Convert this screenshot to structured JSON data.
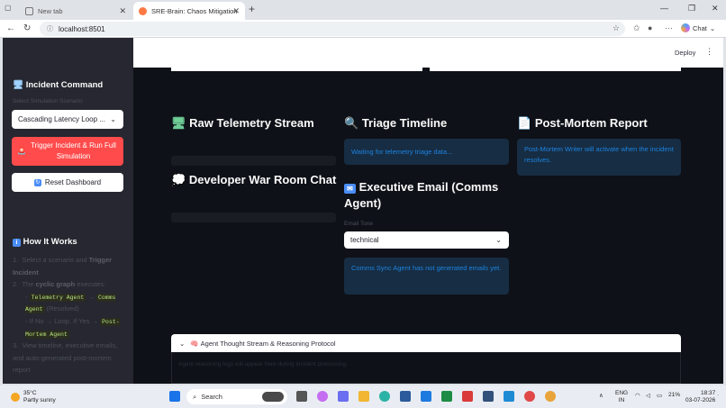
{
  "browser": {
    "tabs": [
      {
        "title": "New tab",
        "active": false
      },
      {
        "title": "SRE-Brain: Chaos Mitigation Centre",
        "active": true
      }
    ],
    "url": "localhost:8501",
    "chat_label": "Chat"
  },
  "header": {
    "deploy_label": "Deploy"
  },
  "sidebar": {
    "title": "Incident Command",
    "scenario_label": "Select Simulation Scenario",
    "scenario_value": "Cascading Latency Loop ...",
    "trigger_button": "Trigger Incident & Run Full Simulation",
    "reset_button": "Reset Dashboard",
    "how_title": "How It Works",
    "how": {
      "step1_pre": "Select a scenario and ",
      "step1_bold": "Trigger Incident",
      "step2_pre": "The ",
      "step2_bold": "cyclic graph",
      "step2_post": " executes:",
      "sub1_code_a": "Telemetry Agent",
      "sub1_arrow": " → ",
      "sub1_code_b": "Comms Agent",
      "sub1_post": " (Resolved)",
      "sub2_pre": "If No → Loop. If Yes → ",
      "sub2_code": "Post-Mortem Agent",
      "step3": "View timeline, executive emails, and auto-generated post-mortem report"
    }
  },
  "main": {
    "telemetry_title": "Raw Telemetry Stream",
    "warroom_title": "Developer War Room Chat",
    "triage_title": "Triage Timeline",
    "triage_info": "Waiting for telemetry triage data...",
    "email_title": "Executive Email (Comms Agent)",
    "email_tone_label": "Email Tone",
    "email_tone_value": "technical",
    "email_info": "Comms Sync Agent has not generated emails yet.",
    "postmortem_title": "Post-Mortem Report",
    "postmortem_info": "Post-Mortem Writer will activate when the incident resolves.",
    "expander_title": "Agent Thought Stream & Reasoning Protocol",
    "expander_body": "Agent reasoning logs will appear here during incident processing."
  },
  "taskbar": {
    "weather_temp": "35°C",
    "weather_desc": "Partly sunny",
    "search_placeholder": "Search",
    "lang_top": "ENG",
    "lang_bottom": "IN",
    "battery": "21%",
    "time": "18:37",
    "date": "03-07-2026"
  },
  "colors": {
    "primary_red": "#ff4b4b",
    "app_bg": "#0e1117",
    "sidebar_bg": "#262730",
    "info_bg": "#172d43",
    "info_text": "#1c83e1"
  }
}
